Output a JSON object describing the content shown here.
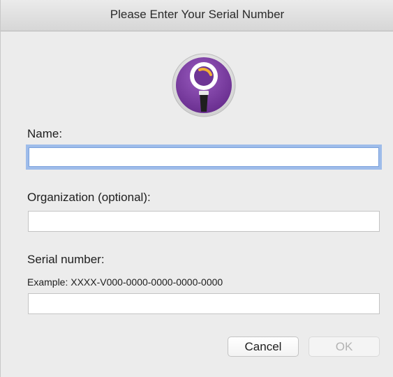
{
  "window": {
    "title": "Please Enter Your Serial Number"
  },
  "icon": {
    "name": "magnifier-app-icon",
    "accent": "#7b3fa0",
    "highlight": "#f2b132"
  },
  "form": {
    "name": {
      "label": "Name:",
      "value": "",
      "placeholder": ""
    },
    "organization": {
      "label": "Organization (optional):",
      "value": "",
      "placeholder": ""
    },
    "serial": {
      "label": "Serial number:",
      "hint": "Example: XXXX-V000-0000-0000-0000-0000",
      "value": "",
      "placeholder": ""
    }
  },
  "buttons": {
    "cancel": "Cancel",
    "ok": "OK"
  },
  "colors": {
    "focus_ring": "#9ebcea",
    "disabled_text": "#b3b3b3"
  }
}
